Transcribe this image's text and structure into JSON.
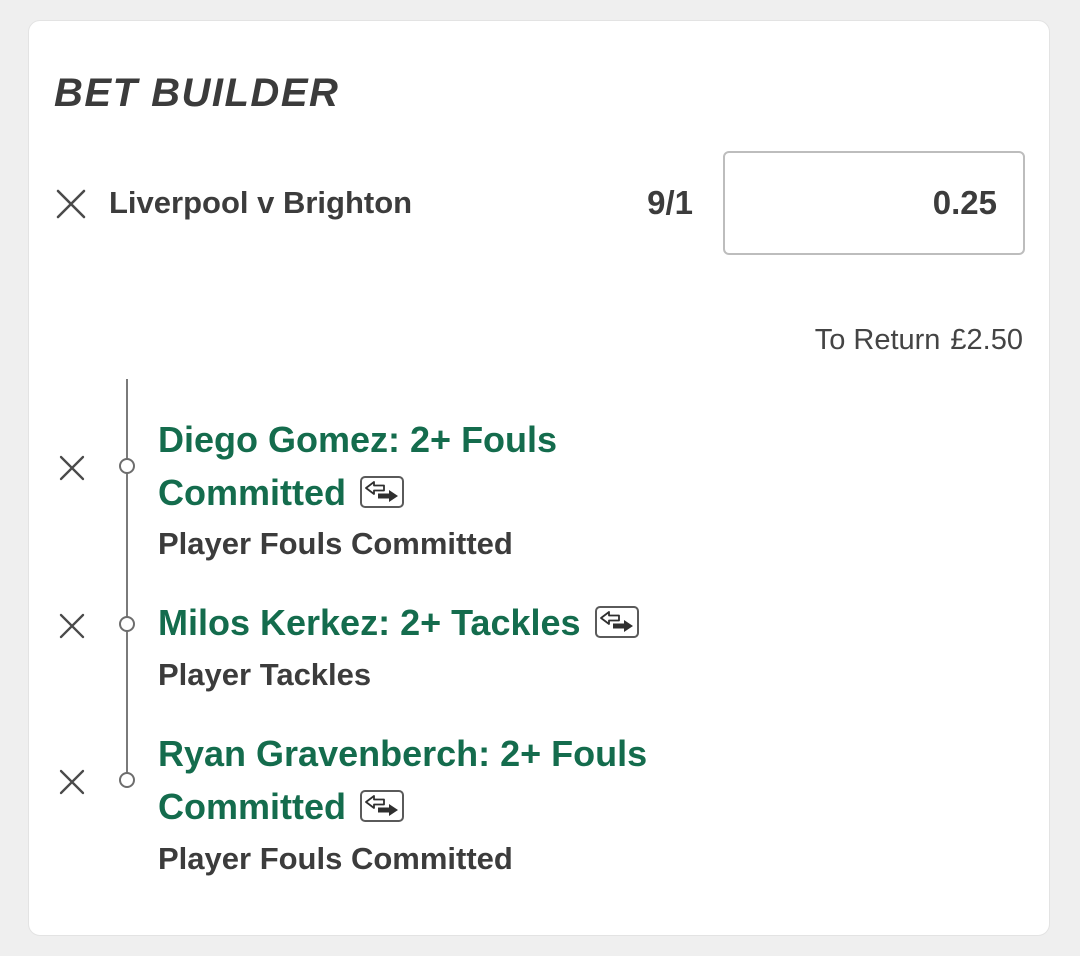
{
  "bet_builder": {
    "title": "BET BUILDER",
    "event": "Liverpool v Brighton",
    "odds": "9/1",
    "stake_value": "0.25",
    "to_return_label": "To Return",
    "to_return_value": "£2.50",
    "selections": [
      {
        "title": "Diego Gomez: 2+ Fouls Committed",
        "market": "Player Fouls Committed"
      },
      {
        "title": "Milos Kerkez: 2+ Tackles",
        "market": "Player Tackles"
      },
      {
        "title": "Ryan Gravenberch: 2+ Fouls Committed",
        "market": "Player Fouls Committed"
      }
    ]
  },
  "colors": {
    "selection_green": "#146c4d",
    "text_dark": "#3c3c3c",
    "page_background": "#efefef"
  },
  "icons": {
    "remove": "close-icon",
    "swap": "swap-arrows-icon"
  }
}
